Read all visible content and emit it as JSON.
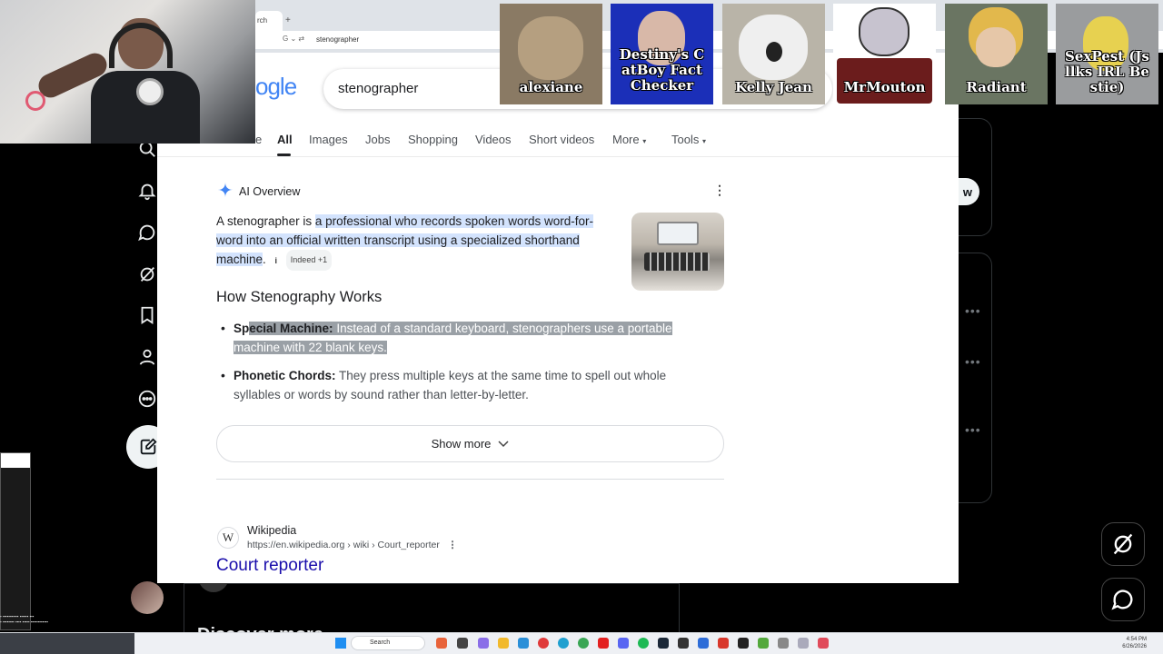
{
  "browser": {
    "tab_label": "rch",
    "address": "stenographer"
  },
  "search": {
    "logo_fragment": "ogle",
    "query": "stenographer"
  },
  "tabs": [
    {
      "label": "e"
    },
    {
      "label": "All"
    },
    {
      "label": "Images"
    },
    {
      "label": "Jobs"
    },
    {
      "label": "Shopping"
    },
    {
      "label": "Videos"
    },
    {
      "label": "Short videos"
    },
    {
      "label": "More"
    },
    {
      "label": "Tools"
    }
  ],
  "ai_overview": {
    "header": "AI Overview",
    "intro_plain": "A stenographer is ",
    "intro_highlight": "a professional who records spoken words word-for-word into an official written transcript using a specialized shorthand machine",
    "intro_end": ".",
    "source_chip": "Indeed +1",
    "section_title": "How Stenography Works",
    "bullets": [
      {
        "title_plain": "Sp",
        "title_sel": "ecial Machine:",
        "text": " Instead of a standard keyboard, stenographers use a portable machine with 22 blank keys."
      },
      {
        "title": "Phonetic Chords:",
        "text": " They press multiple keys at the same time to spell out whole syllables or words by sound rather than letter-by-letter."
      }
    ],
    "show_more": "Show more"
  },
  "result": {
    "site_name": "Wikipedia",
    "url": "https://en.wikipedia.org › wiki › Court_reporter",
    "title": "Court reporter",
    "icon_letter": "W"
  },
  "background_app": {
    "follow_button": "w",
    "discover": "Discover more"
  },
  "emotes": [
    {
      "label": "alexiane",
      "color": "#8a7a64"
    },
    {
      "label": "Destiny's C atBoy Fact Checker",
      "color": "#1b2fb8"
    },
    {
      "label": "Kelly Jean",
      "color": "#b9b4a8"
    },
    {
      "label": "MrMouton",
      "color": "#ffffff"
    },
    {
      "label": "Radiant",
      "color": "#6a7562"
    },
    {
      "label": "SexPest (Js llks IRL Be stie)",
      "color": "#9a9c9e"
    }
  ],
  "taskbar": {
    "search_label": "Search",
    "time": "4:54 PM",
    "date": "6/26/2026"
  },
  "colors": {
    "link": "#1a0dab",
    "highlight": "#d3e3fd",
    "selection": "#9aa0a6"
  }
}
